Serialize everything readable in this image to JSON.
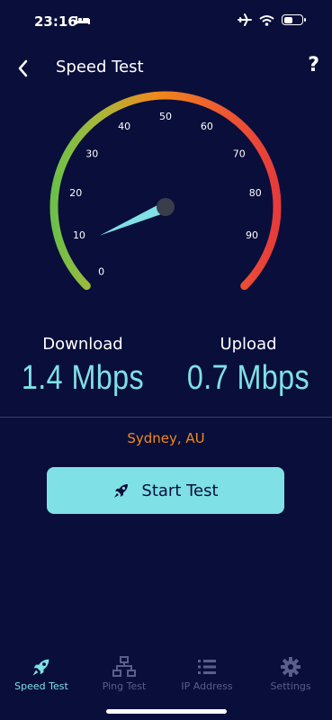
{
  "status": {
    "time": "23:16"
  },
  "header": {
    "title": "Speed Test",
    "help": "?"
  },
  "gauge": {
    "ticks": [
      "0",
      "10",
      "20",
      "30",
      "40",
      "50",
      "60",
      "70",
      "80",
      "90"
    ],
    "needle_value": 8
  },
  "stats": {
    "download": {
      "label": "Download",
      "value": "1.4 Mbps"
    },
    "upload": {
      "label": "Upload",
      "value": "0.7 Mbps"
    }
  },
  "location": "Sydney, AU",
  "start_button": {
    "label": "Start Test"
  },
  "tabs": [
    {
      "label": "Speed Test",
      "icon": "rocket-icon",
      "active": true
    },
    {
      "label": "Ping Test",
      "icon": "network-icon",
      "active": false
    },
    {
      "label": "IP Address",
      "icon": "list-icon",
      "active": false
    },
    {
      "label": "Settings",
      "icon": "gear-icon",
      "active": false
    }
  ],
  "colors": {
    "background": "#0a0e3a",
    "accent": "#7fe0e6",
    "location": "#f08a1c",
    "gauge_start": "#6cc04a",
    "gauge_mid": "#f08a1c",
    "gauge_end": "#e63b3b"
  }
}
